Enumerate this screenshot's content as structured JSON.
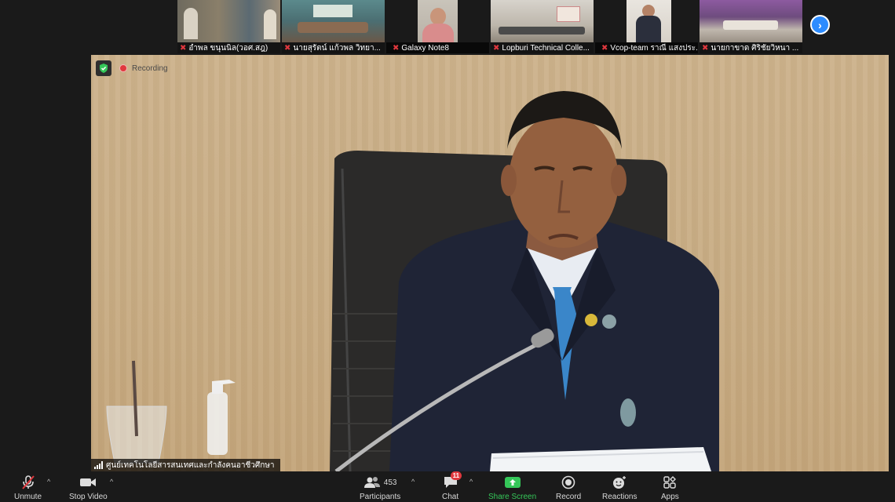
{
  "participants_strip": [
    {
      "name": "อำพล ขนุนนิล(วอศ.สฎ)",
      "muted": true
    },
    {
      "name": "นายสุรัตน์ แก้วพล วิทยา...",
      "muted": true
    },
    {
      "name": "Galaxy Note8",
      "muted": true
    },
    {
      "name": "Lopburi Technical Colle...",
      "muted": true
    },
    {
      "name": "Vcop-team ราณี แสงประ...",
      "muted": true
    },
    {
      "name": "นายกาขาด ศิริชัยวิหนา ...",
      "muted": true
    }
  ],
  "recording": {
    "label": "Recording"
  },
  "speaker": {
    "name": "ศูนย์เทคโนโลยีสารสนเทศและกำลังคนอาชีวศึกษา"
  },
  "toolbar": {
    "unmute": "Unmute",
    "stop_video": "Stop Video",
    "participants": "Participants",
    "participants_count": "453",
    "chat": "Chat",
    "chat_badge": "11",
    "share_screen": "Share Screen",
    "record": "Record",
    "reactions": "Reactions",
    "apps": "Apps"
  },
  "colors": {
    "accent": "#2d8cff",
    "muted_red": "#e0383e",
    "share_green": "#35c759",
    "background": "#1a1a1a"
  }
}
